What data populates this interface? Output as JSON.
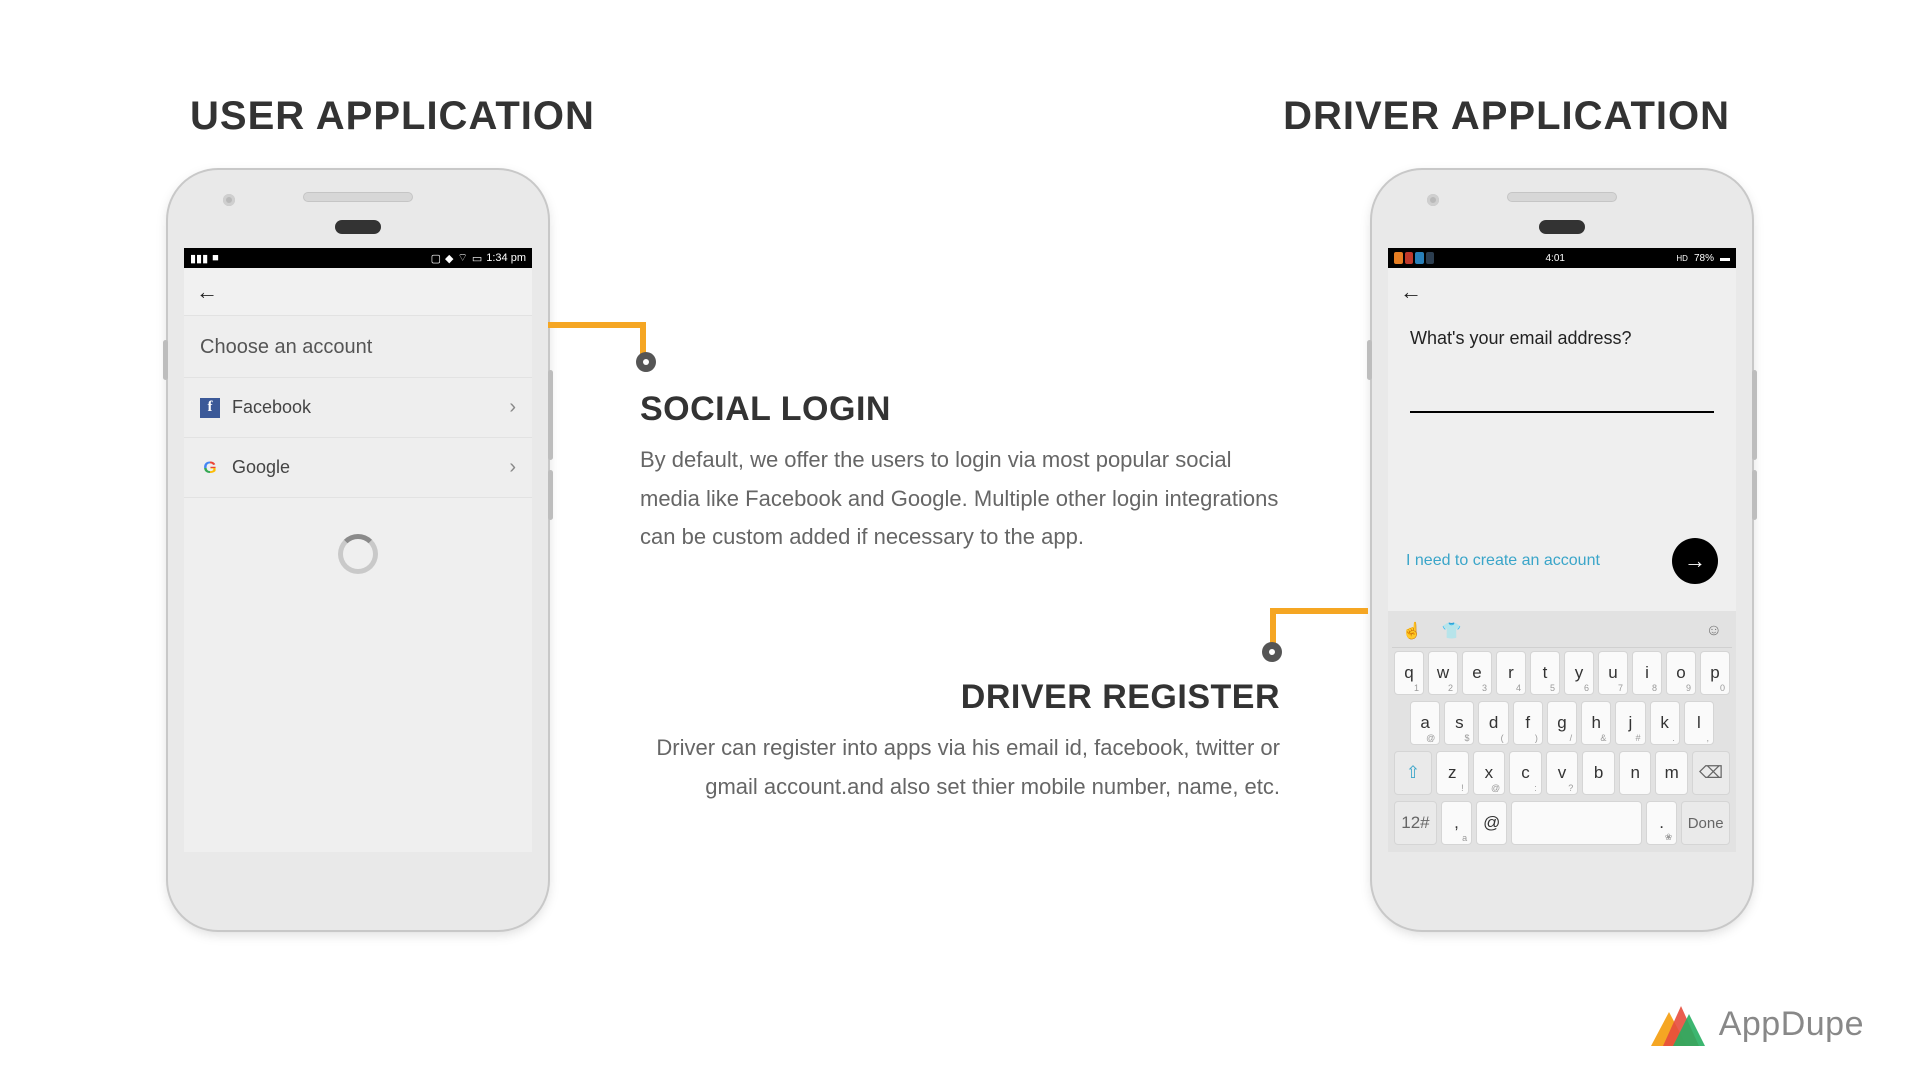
{
  "headings": {
    "left": "USER APPLICATION",
    "right": "DRIVER APPLICATION"
  },
  "user_phone": {
    "status": {
      "time": "1:34 pm"
    },
    "chooser_title": "Choose an account",
    "options": {
      "facebook": "Facebook",
      "google": "Google"
    }
  },
  "driver_phone": {
    "status": {
      "time": "4:01",
      "battery": "78%"
    },
    "prompt": "What's your email address?",
    "email_value": "",
    "create_account_link": "I need to create an account",
    "keyboard": {
      "row1": [
        {
          "k": "q",
          "s": "1"
        },
        {
          "k": "w",
          "s": "2"
        },
        {
          "k": "e",
          "s": "3"
        },
        {
          "k": "r",
          "s": "4"
        },
        {
          "k": "t",
          "s": "5"
        },
        {
          "k": "y",
          "s": "6"
        },
        {
          "k": "u",
          "s": "7"
        },
        {
          "k": "i",
          "s": "8"
        },
        {
          "k": "o",
          "s": "9"
        },
        {
          "k": "p",
          "s": "0"
        }
      ],
      "row2": [
        {
          "k": "a",
          "s": "@"
        },
        {
          "k": "s",
          "s": "$"
        },
        {
          "k": "d",
          "s": "("
        },
        {
          "k": "f",
          "s": ")"
        },
        {
          "k": "g",
          "s": "/"
        },
        {
          "k": "h",
          "s": "&"
        },
        {
          "k": "j",
          "s": "#"
        },
        {
          "k": "k",
          "s": "."
        },
        {
          "k": "l",
          "s": ","
        }
      ],
      "row3": [
        {
          "k": "z",
          "s": "!"
        },
        {
          "k": "x",
          "s": "@"
        },
        {
          "k": "c",
          "s": ":"
        },
        {
          "k": "v",
          "s": "?"
        },
        {
          "k": "b",
          "s": ""
        },
        {
          "k": "n",
          "s": ""
        },
        {
          "k": "m",
          "s": ""
        }
      ],
      "mode_key": "12#",
      "sym_key": "@",
      "done_key": "Done",
      "comma_key": ",",
      "period_key": "."
    }
  },
  "callouts": {
    "social_login": {
      "title": "SOCIAL LOGIN",
      "body": "By default, we offer the users to login via most popular social media like Facebook and Google. Multiple other login integrations can be custom added if necessary to the app."
    },
    "driver_register": {
      "title": "DRIVER REGISTER",
      "body": "Driver can register into apps via his email id, facebook, twitter or gmail account.and also set thier mobile number, name, etc."
    }
  },
  "brand": {
    "name": "AppDupe"
  }
}
